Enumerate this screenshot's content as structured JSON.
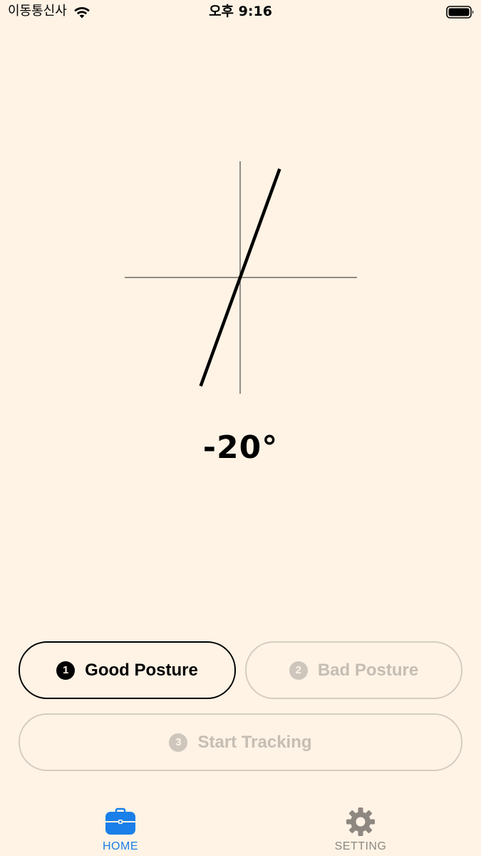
{
  "status_bar": {
    "carrier": "이동통신사",
    "time": "오후 9:16",
    "wifi_icon": "wifi-icon",
    "battery_icon": "battery-full-icon"
  },
  "gauge": {
    "angle_value": -20,
    "angle_label": "-20°"
  },
  "steps": {
    "good": {
      "number": "1",
      "label": "Good Posture",
      "state": "active"
    },
    "bad": {
      "number": "2",
      "label": "Bad Posture",
      "state": "disabled"
    },
    "track": {
      "number": "3",
      "label": "Start Tracking",
      "state": "disabled"
    }
  },
  "tab_bar": {
    "home": {
      "label": "HOME",
      "icon": "toolbox-icon",
      "selected": true
    },
    "setting": {
      "label": "SETTING",
      "icon": "gear-icon",
      "selected": false
    }
  },
  "colors": {
    "background": "#FEF3E5",
    "accent": "#1A7FE8",
    "disabled": "#C6BDB3"
  }
}
